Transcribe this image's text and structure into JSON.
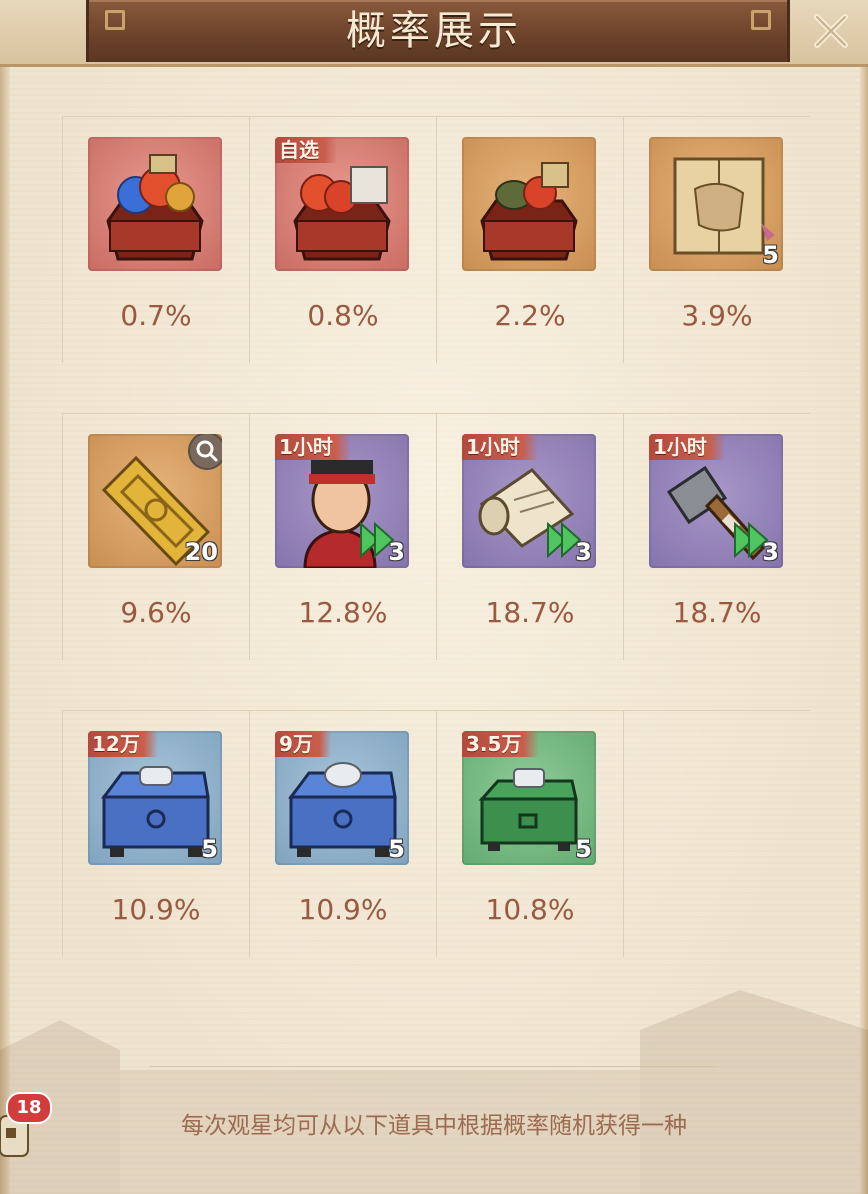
{
  "window": {
    "title": "概率展示",
    "close_icon": "close-icon"
  },
  "items": [
    {
      "rarity": "red",
      "badge": "",
      "count": "",
      "probability": "0.7%",
      "icon": "treasure-box-gems-icon"
    },
    {
      "rarity": "red",
      "badge": "自选",
      "count": "",
      "probability": "0.8%",
      "icon": "treasure-box-select-icon"
    },
    {
      "rarity": "orange",
      "badge": "",
      "count": "",
      "probability": "2.2%",
      "icon": "treasure-box-icon"
    },
    {
      "rarity": "orange",
      "badge": "",
      "count": "5",
      "probability": "3.9%",
      "icon": "blueprint-book-icon"
    },
    {
      "rarity": "orange",
      "badge": "",
      "count": "20",
      "probability": "9.6%",
      "icon": "gold-token-icon",
      "has_magnifier": true
    },
    {
      "rarity": "purple",
      "badge": "1小时",
      "count": "3",
      "probability": "12.8%",
      "icon": "speedup-official-icon"
    },
    {
      "rarity": "purple",
      "badge": "1小时",
      "count": "3",
      "probability": "18.7%",
      "icon": "speedup-scroll-icon"
    },
    {
      "rarity": "purple",
      "badge": "1小时",
      "count": "3",
      "probability": "18.7%",
      "icon": "speedup-hammer-icon"
    },
    {
      "rarity": "blue",
      "badge": "12万",
      "count": "5",
      "probability": "10.9%",
      "icon": "silver-chest-icon"
    },
    {
      "rarity": "blue",
      "badge": "9万",
      "count": "5",
      "probability": "10.9%",
      "icon": "silver-chest-icon"
    },
    {
      "rarity": "green",
      "badge": "3.5万",
      "count": "5",
      "probability": "10.8%",
      "icon": "silver-chest-small-icon"
    }
  ],
  "footer": {
    "text": "每次观星均可从以下道具中根据概率随机获得一种"
  },
  "side": {
    "notification_count": "18"
  }
}
